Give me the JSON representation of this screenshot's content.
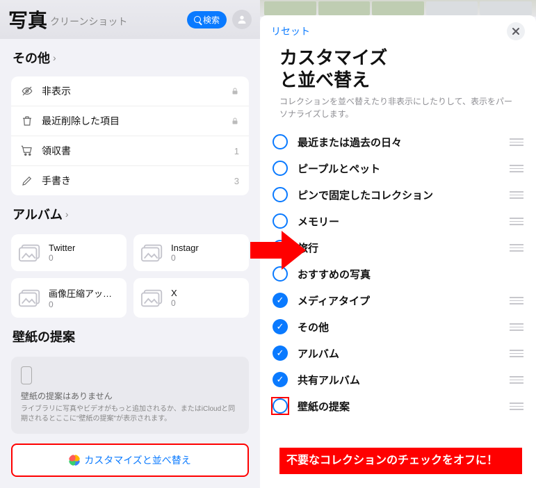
{
  "left": {
    "title": "写真",
    "subtitle": "クリーンショット",
    "search_label": "検索",
    "section_other": "その他",
    "other_items": [
      {
        "label": "非表示",
        "trail_lock": true
      },
      {
        "label": "最近削除した項目",
        "trail_lock": true
      },
      {
        "label": "領収書",
        "trail": "1"
      },
      {
        "label": "手書き",
        "trail": "3"
      }
    ],
    "section_album": "アルバム",
    "albums": [
      {
        "name": "Twitter",
        "count": "0"
      },
      {
        "name": "Instagr",
        "count": "0"
      },
      {
        "name": "画像圧縮アッシュ",
        "count": "0"
      },
      {
        "name": "X",
        "count": "0"
      }
    ],
    "section_wallpaper": "壁紙の提案",
    "wallpaper_none_title": "壁紙の提案はありません",
    "wallpaper_none_desc": "ライブラリに写真やビデオがもっと追加されるか、またはiCloudと同期されるとここに\"壁紙の提案\"が表示されます。",
    "customize_button": "カスタマイズと並べ替え"
  },
  "right": {
    "reset": "リセット",
    "title_line1": "カスタマイズ",
    "title_line2": "と並べ替え",
    "desc": "コレクションを並べ替えたり非表示にしたりして、表示をパーソナライズします。",
    "options": [
      {
        "label": "最近または過去の日々",
        "checked": false,
        "handle": true
      },
      {
        "label": "ピープルとペット",
        "checked": false,
        "handle": true
      },
      {
        "label": "ピンで固定したコレクション",
        "checked": false,
        "handle": true
      },
      {
        "label": "メモリー",
        "checked": false,
        "handle": true
      },
      {
        "label": "旅行",
        "checked": false,
        "handle": true
      },
      {
        "label": "おすすめの写真",
        "checked": false,
        "handle": false
      },
      {
        "label": "メディアタイプ",
        "checked": true,
        "handle": true
      },
      {
        "label": "その他",
        "checked": true,
        "handle": true
      },
      {
        "label": "アルバム",
        "checked": true,
        "handle": true
      },
      {
        "label": "共有アルバム",
        "checked": true,
        "handle": true
      },
      {
        "label": "壁紙の提案",
        "checked": false,
        "handle": true,
        "redbox": true
      }
    ],
    "callout": "不要なコレクションのチェックをオフに！"
  }
}
